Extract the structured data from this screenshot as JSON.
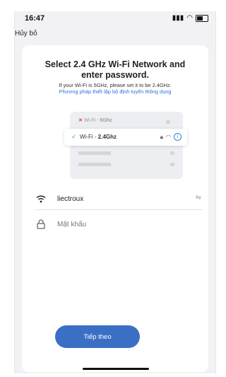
{
  "status_bar": {
    "time": "16:47",
    "icons": [
      "location-arrow-icon",
      "signal-icon",
      "wifi-icon",
      "battery-icon"
    ]
  },
  "nav": {
    "cancel_label": "Hủy bỏ"
  },
  "card": {
    "title_line1": "Select 2.4 GHz Wi-Fi Network and",
    "title_line2": "enter password.",
    "subtitle": "If your Wi-Fi is 5GHz, please set it to be 2.4GHz.",
    "link": "Phương pháp thiết lập bộ định tuyến thông dụng"
  },
  "illustration": {
    "wifi5_label": "Wi-Fi - ",
    "wifi5_band": "5Ghz",
    "wifi24_label": "Wi-Fi - ",
    "wifi24_band": "2.4Ghz"
  },
  "form": {
    "ssid": "liectroux",
    "password_placeholder": "Mật khẩu",
    "password_value": ""
  },
  "actions": {
    "next_label": "Tiếp theo"
  },
  "colors": {
    "accent": "#3a6fc4",
    "link": "#2f6fe0",
    "check": "#2bb36b",
    "error": "#e53935"
  }
}
